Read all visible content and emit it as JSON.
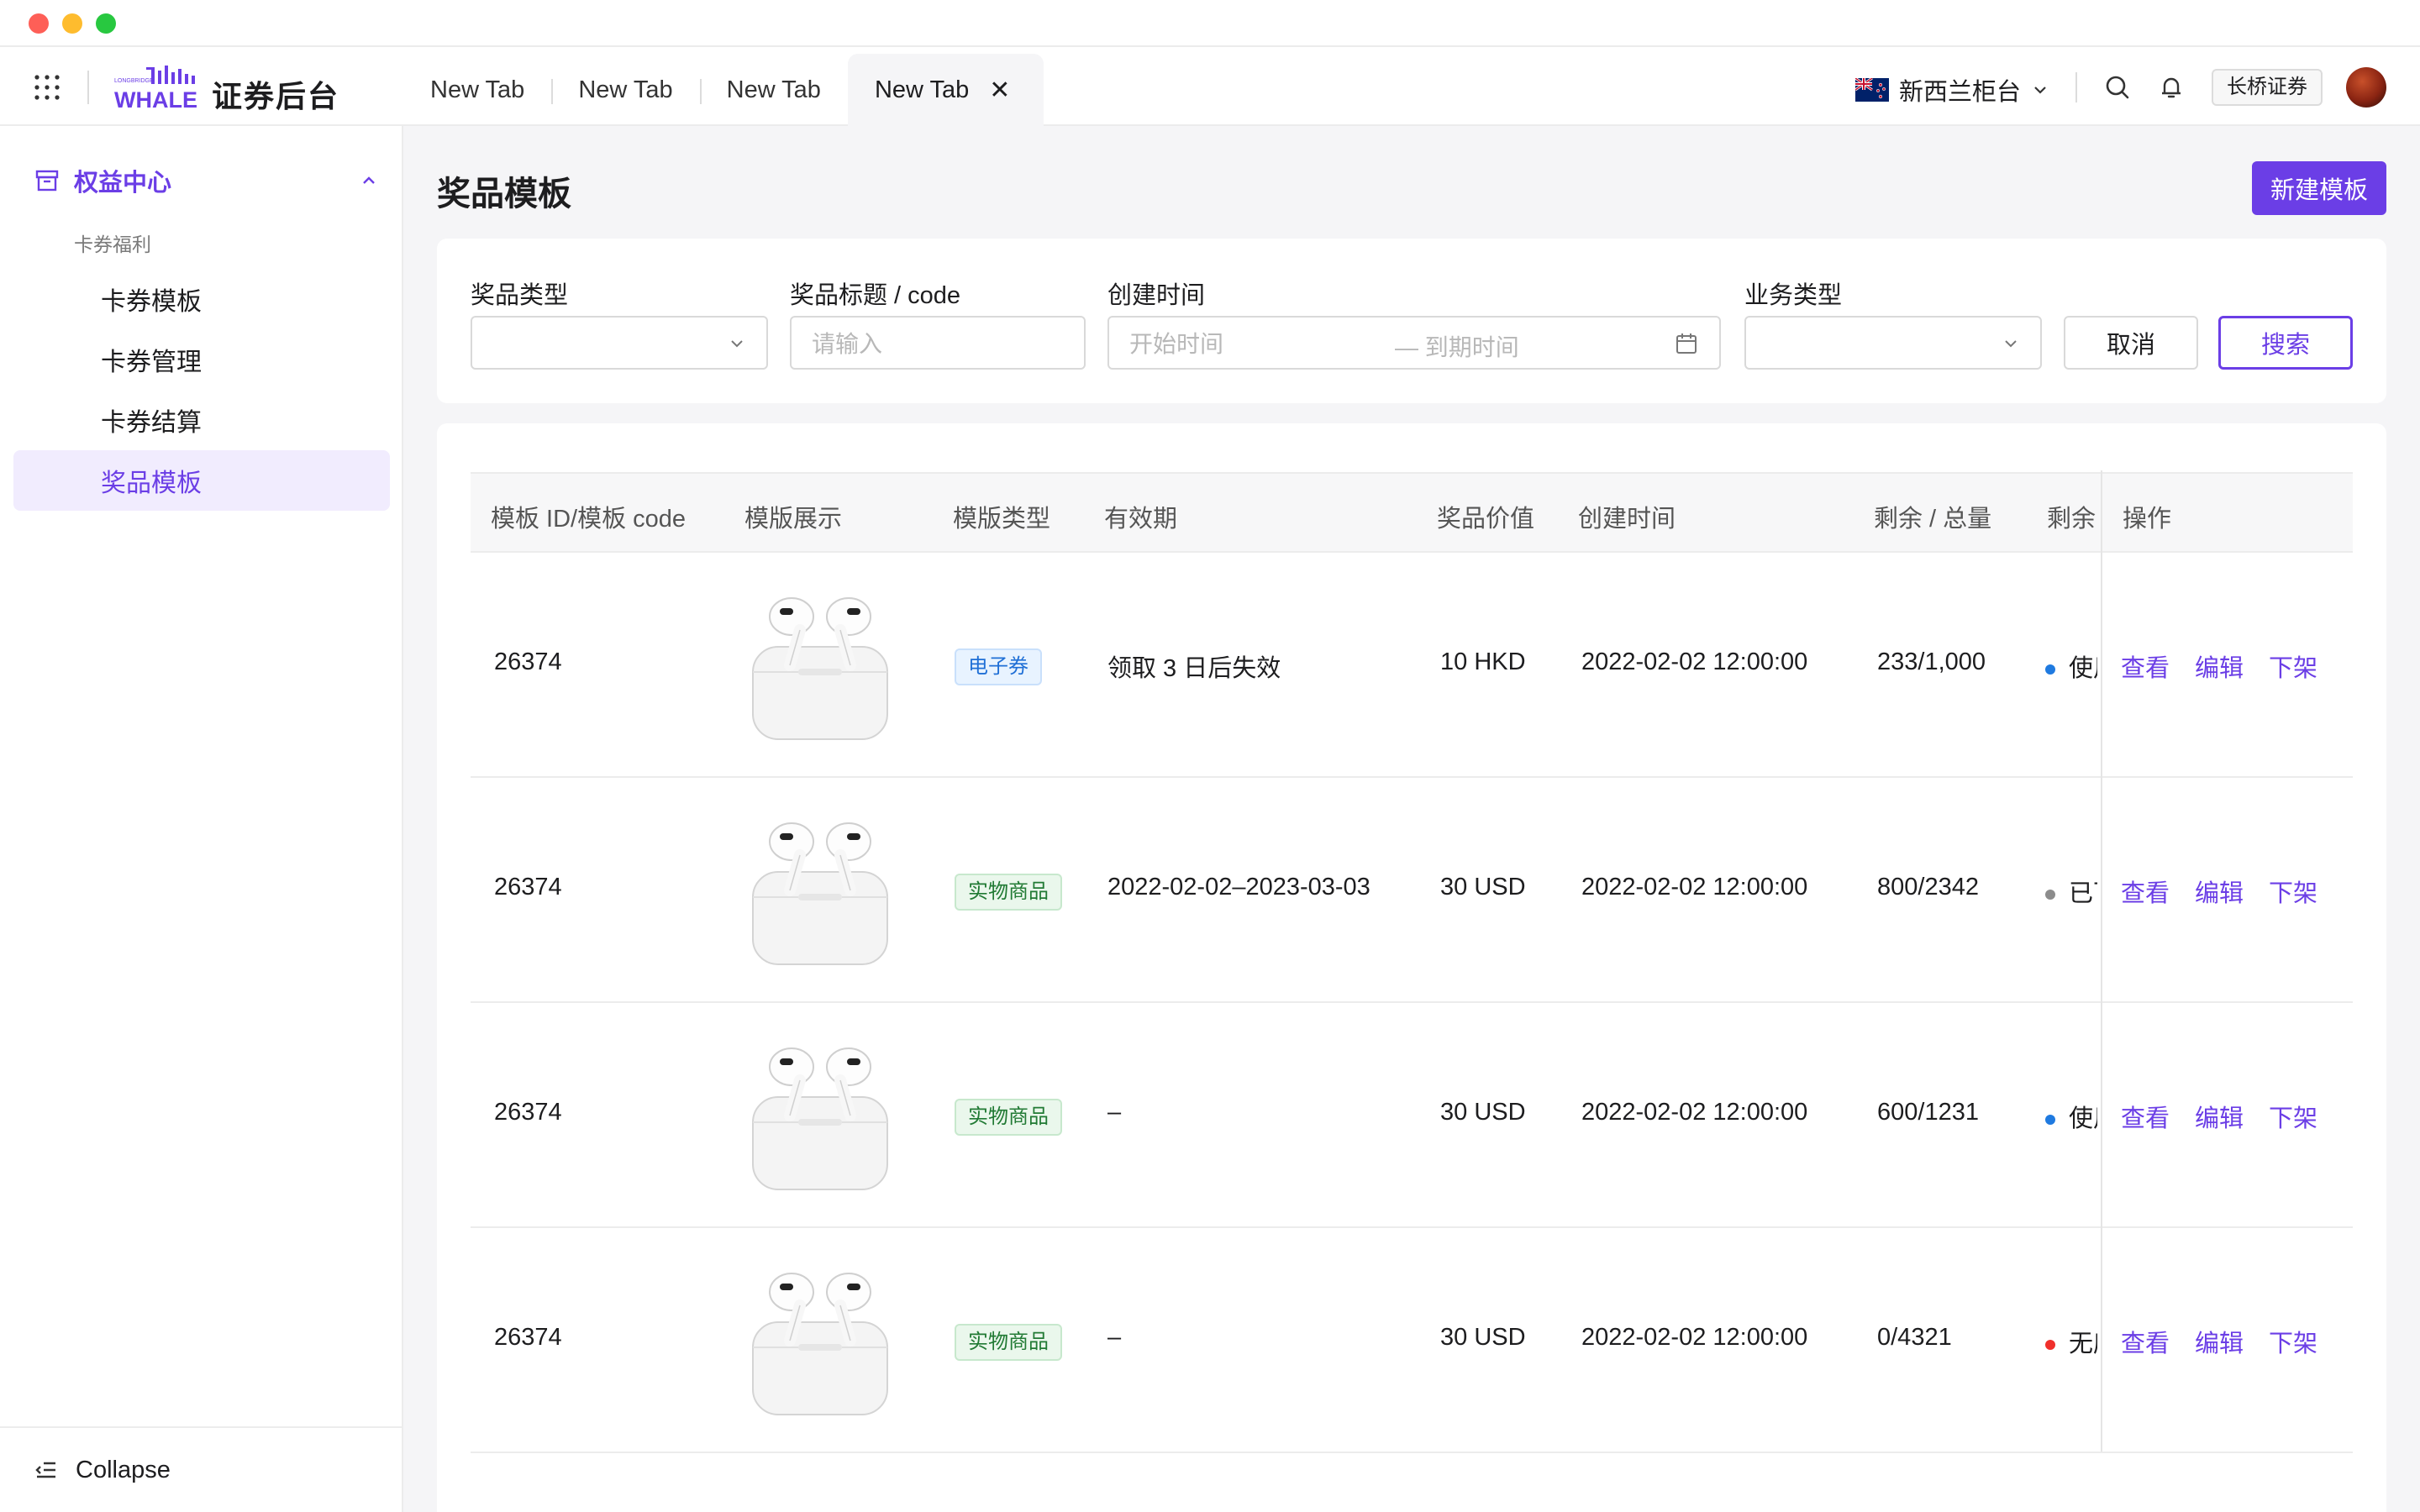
{
  "window": {
    "controls": [
      "close",
      "minimize",
      "zoom"
    ]
  },
  "header": {
    "logo_text": "WHALE",
    "logo_small": "LONGBRIDGE",
    "brand": "证券后台",
    "tabs": [
      {
        "label": "New Tab",
        "active": false
      },
      {
        "label": "New Tab",
        "active": false
      },
      {
        "label": "New Tab",
        "active": false
      },
      {
        "label": "New Tab",
        "active": true
      }
    ],
    "region": "新西兰柜台",
    "org_button": "长桥证券",
    "icons": [
      "apps-grid-icon",
      "search-icon",
      "bell-icon",
      "chevron-down-icon",
      "close-icon"
    ]
  },
  "sidebar": {
    "group": "权益中心",
    "subgroup": "卡券福利",
    "items": [
      {
        "label": "卡券模板",
        "active": false
      },
      {
        "label": "卡券管理",
        "active": false
      },
      {
        "label": "卡券结算",
        "active": false
      },
      {
        "label": "奖品模板",
        "active": true
      }
    ],
    "collapse_label": "Collapse"
  },
  "page": {
    "title": "奖品模板",
    "create_button": "新建模板"
  },
  "filters": {
    "prize_type": {
      "label": "奖品类型",
      "value": ""
    },
    "prize_title": {
      "label": "奖品标题 / code",
      "placeholder": "请输入"
    },
    "created_time": {
      "label": "创建时间",
      "start_placeholder": "开始时间",
      "separator": "—",
      "end_placeholder": "到期时间"
    },
    "business_type": {
      "label": "业务类型",
      "value": ""
    },
    "cancel_button": "取消",
    "search_button": "搜索"
  },
  "table": {
    "columns": [
      "模板 ID/模板 code",
      "模版展示",
      "模版类型",
      "有效期",
      "奖品价值",
      "创建时间",
      "剩余 / 总量",
      "剩余",
      "操作"
    ],
    "rows": [
      {
        "id": "26374",
        "image": "airpods-pro-image",
        "type": "电子券",
        "type_color": "blue",
        "validity": "领取 3 日后失效",
        "value": "10 HKD",
        "created": "2022-02-02 12:00:00",
        "remaining": "233/1,000",
        "status": "使用中",
        "status_color": "#1f7ae0",
        "actions": [
          "查看",
          "编辑",
          "下架"
        ]
      },
      {
        "id": "26374",
        "image": "airpods-pro-image",
        "type": "实物商品",
        "type_color": "green",
        "validity": "2022-02-02–2023-03-03",
        "value": "30 USD",
        "created": "2022-02-02 12:00:00",
        "remaining": "800/2342",
        "status": "已下架",
        "status_color": "#8c8c8c",
        "actions": [
          "查看",
          "编辑",
          "下架"
        ]
      },
      {
        "id": "26374",
        "image": "airpods-pro-image",
        "type": "实物商品",
        "type_color": "green",
        "validity": "–",
        "value": "30 USD",
        "created": "2022-02-02 12:00:00",
        "remaining": "600/1231",
        "status": "使用中",
        "status_color": "#1f7ae0",
        "actions": [
          "查看",
          "编辑",
          "下架"
        ]
      },
      {
        "id": "26374",
        "image": "airpods-pro-image",
        "type": "实物商品",
        "type_color": "green",
        "validity": "–",
        "value": "30 USD",
        "created": "2022-02-02 12:00:00",
        "remaining": "0/4321",
        "status": "无库存",
        "status_color": "#f0302c",
        "actions": [
          "查看",
          "编辑",
          "下架"
        ]
      }
    ]
  },
  "colors": {
    "accent": "#6b3ee6",
    "accent_light": "#f1ecfe",
    "link": "#6b3ee6"
  }
}
